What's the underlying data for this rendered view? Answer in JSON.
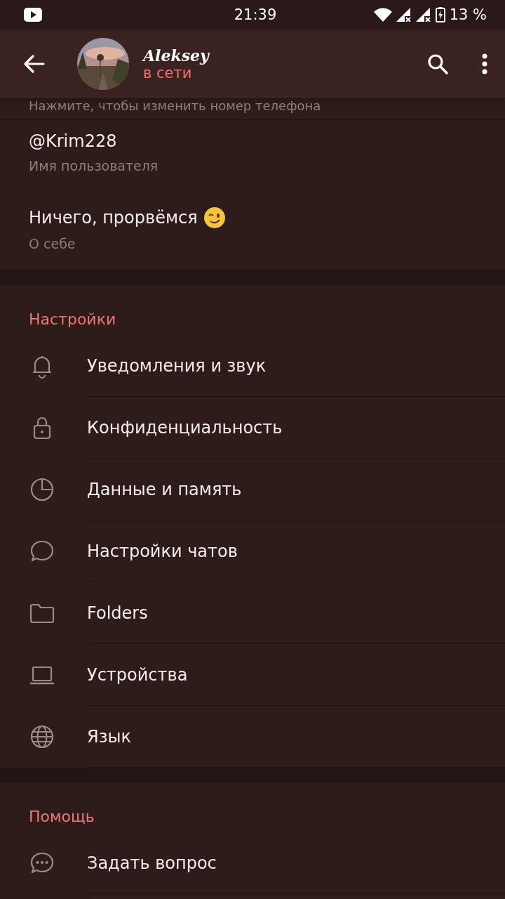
{
  "status_bar": {
    "time": "21:39",
    "battery": "13 %"
  },
  "header": {
    "name": "Aleksey",
    "status": "в сети"
  },
  "profile": {
    "phone_hint": "Нажмите, чтобы изменить номер телефона",
    "fields": [
      {
        "value": "@Krim228",
        "label": "Имя пользователя",
        "kind": "text"
      },
      {
        "value": "Ничего, прорвёмся",
        "label": "О себе",
        "kind": "wink"
      }
    ]
  },
  "sections": [
    {
      "title": "Настройки",
      "items": [
        {
          "label": "Уведомления и звук",
          "kind": "bell"
        },
        {
          "label": "Конфиденциальность",
          "kind": "lock"
        },
        {
          "label": "Данные и память",
          "kind": "pie"
        },
        {
          "label": "Настройки чатов",
          "kind": "chat"
        },
        {
          "label": "Folders",
          "kind": "folder"
        },
        {
          "label": "Устройства",
          "kind": "laptop"
        },
        {
          "label": "Язык",
          "kind": "globe"
        }
      ]
    },
    {
      "title": "Помощь",
      "items": [
        {
          "label": "Задать вопрос",
          "kind": "dots"
        }
      ]
    }
  ]
}
